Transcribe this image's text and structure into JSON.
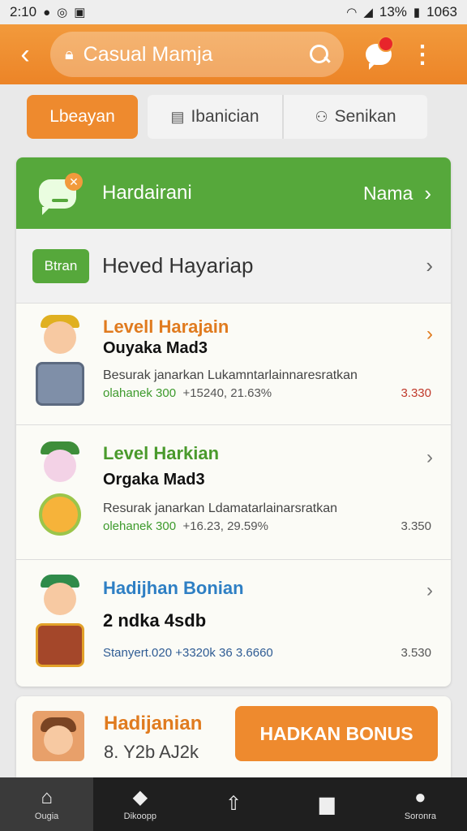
{
  "status_bar": {
    "time": "2:10",
    "battery": "13%",
    "clock": "1063"
  },
  "app_bar": {
    "title": "Casual Mamja",
    "icons": [
      "back-arrow-icon",
      "lock-icon",
      "search-icon",
      "chat-notification-icon",
      "more-vert-icon"
    ]
  },
  "tabs": [
    {
      "label": "Lbeayan",
      "active": true
    },
    {
      "label": "Ibanician",
      "active": false
    },
    {
      "label": "Senikan",
      "active": false
    }
  ],
  "green_header": {
    "title": "Hardairani",
    "link": "Nama"
  },
  "section": {
    "badge": "Btran",
    "title": "Heved Hayariap"
  },
  "items": [
    {
      "title": "Levell Harajain",
      "title_color": "#e07b1f",
      "subtitle": "Ouyaka Mad3",
      "desc": "Besurak janarkan Lukamntarlainnaresratkan",
      "meta_green": "olahanek 300",
      "meta_rest": "+15240, 21.63%",
      "value": "3.330",
      "value_color": "#c0392b"
    },
    {
      "title": "Level Harkian",
      "title_color": "#4a9a2c",
      "subtitle": "Orgaka Mad3",
      "desc": "Resurak janarkan Ldamatarlainarsratkan",
      "meta_green": "olehanek 300",
      "meta_rest": "+16.23, 29.59%",
      "value": "3.350",
      "value_color": "#555555"
    },
    {
      "title": "Hadijhan Bonian",
      "title_color": "#2e7fc4",
      "subtitle": "2 ndka 4sdb",
      "desc": "",
      "meta_green": "",
      "meta_rest": "Stanyert.020  +3320k 36 3.6660",
      "value": "3.530",
      "value_color": "#555555"
    }
  ],
  "bottom_card": {
    "title": "Hadijanian",
    "subtitle": "8. Y2b AJ2k",
    "button": "HADKAN BONUS"
  },
  "nav": [
    {
      "label": "Ougia",
      "icon": "home-icon",
      "active": true
    },
    {
      "label": "Dikoopp",
      "icon": "tag-icon",
      "active": false
    },
    {
      "label": "",
      "icon": "share-icon",
      "active": false
    },
    {
      "label": "",
      "icon": "gift-icon",
      "active": false
    },
    {
      "label": "Soronra",
      "icon": "profile-icon",
      "active": false
    }
  ]
}
